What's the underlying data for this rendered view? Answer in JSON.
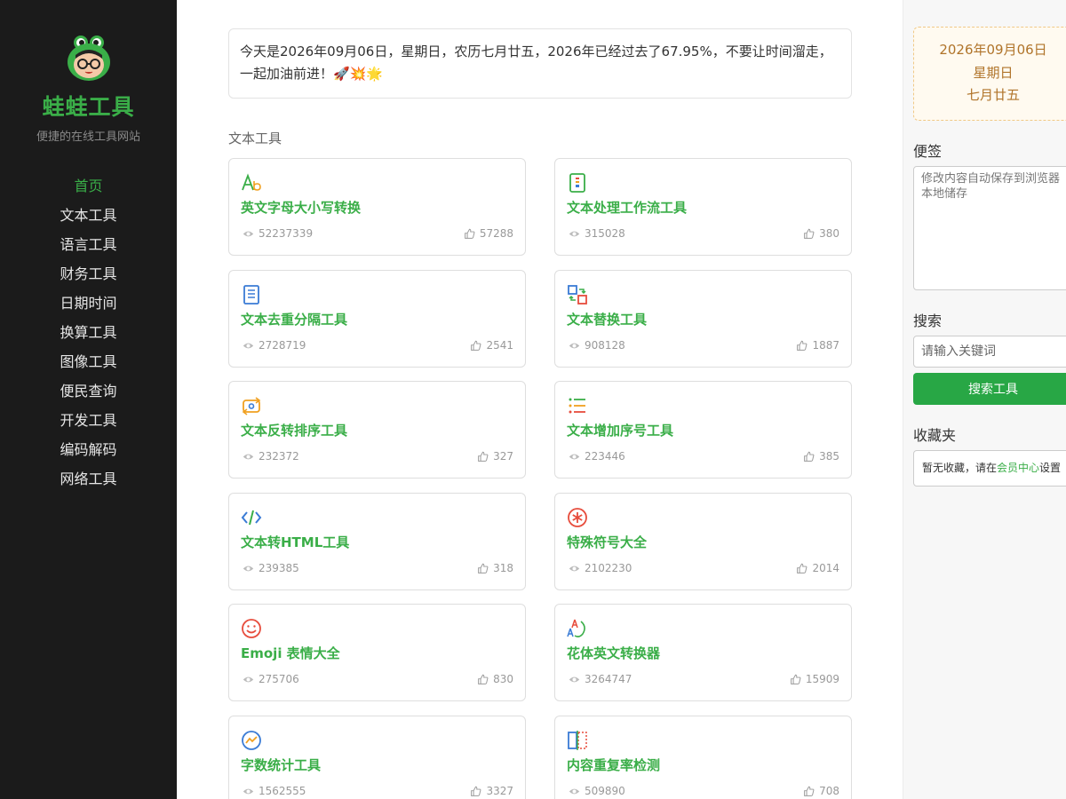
{
  "site": {
    "title": "蛙蛙工具",
    "subtitle": "便捷的在线工具网站",
    "logo": "frog-logo"
  },
  "nav": [
    {
      "label": "首页",
      "active": true
    },
    {
      "label": "文本工具"
    },
    {
      "label": "语言工具"
    },
    {
      "label": "财务工具"
    },
    {
      "label": "日期时间"
    },
    {
      "label": "换算工具"
    },
    {
      "label": "图像工具"
    },
    {
      "label": "便民查询"
    },
    {
      "label": "开发工具"
    },
    {
      "label": "编码解码"
    },
    {
      "label": "网络工具"
    }
  ],
  "notice": {
    "text": "今天是2026年09月06日，星期日，农历七月廿五，2026年已经过去了67.95%，不要让时间溜走，一起加油前进！🚀💥🌟"
  },
  "section": {
    "title": "文本工具"
  },
  "tools": [
    {
      "name": "英文字母大小写转换",
      "views": "52237339",
      "likes": "57288",
      "icon": "letter-case-icon"
    },
    {
      "name": "文本处理工作流工具",
      "views": "315028",
      "likes": "380",
      "icon": "workflow-icon"
    },
    {
      "name": "文本去重分隔工具",
      "views": "2728719",
      "likes": "2541",
      "icon": "document-icon"
    },
    {
      "name": "文本替换工具",
      "views": "908128",
      "likes": "1887",
      "icon": "replace-icon"
    },
    {
      "name": "文本反转排序工具",
      "views": "232372",
      "likes": "327",
      "icon": "reverse-icon"
    },
    {
      "name": "文本增加序号工具",
      "views": "223446",
      "likes": "385",
      "icon": "numbered-list-icon"
    },
    {
      "name": "文本转HTML工具",
      "views": "239385",
      "likes": "318",
      "icon": "code-icon"
    },
    {
      "name": "特殊符号大全",
      "views": "2102230",
      "likes": "2014",
      "icon": "asterisk-icon"
    },
    {
      "name": "Emoji 表情大全",
      "views": "275706",
      "likes": "830",
      "icon": "smiley-icon"
    },
    {
      "name": "花体英文转换器",
      "views": "3264747",
      "likes": "15909",
      "icon": "fancy-font-icon"
    },
    {
      "name": "字数统计工具",
      "views": "1562555",
      "likes": "3327",
      "icon": "chart-circle-icon"
    },
    {
      "name": "内容重复率检测",
      "views": "509890",
      "likes": "708",
      "icon": "compare-icon"
    }
  ],
  "right": {
    "date": "2026年09月06日",
    "weekday": "星期日",
    "lunar": "七月廿五",
    "memo_label": "便签",
    "memo_placeholder": "修改内容自动保存到浏览器本地储存",
    "search_label": "搜索",
    "search_placeholder": "请输入关键词",
    "search_button": "搜索工具",
    "fav_label": "收藏夹",
    "fav_text_before": "暂无收藏，请在",
    "fav_link": "会员中心",
    "fav_text_after": "设置"
  },
  "colors": {
    "accent": "#3aae48",
    "sidebar_bg": "#1b1b1b",
    "search_button": "#28a745",
    "date_text": "#b0742a"
  }
}
